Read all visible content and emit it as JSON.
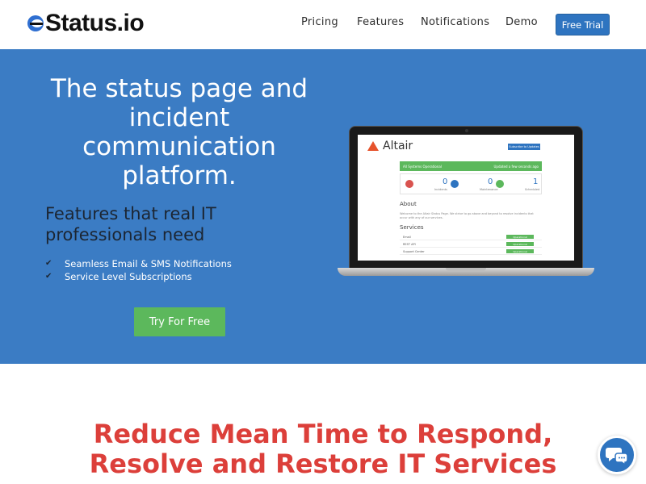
{
  "header": {
    "logo_text": "Status.io",
    "nav": [
      "Pricing",
      "Features",
      "Notifications",
      "Demo"
    ],
    "trial_button": "Free Trial"
  },
  "hero": {
    "title": "The status page and incident communication platform.",
    "subtitle": "Features that real IT professionals need",
    "features": [
      "Seamless Email & SMS Notifications",
      "Service Level Subscriptions"
    ],
    "cta": "Try For Free"
  },
  "preview": {
    "logo": "Altair",
    "subscribe": "Subscribe to Updates",
    "banner": "All Systems Operational",
    "banner_time": "Updated a few seconds ago",
    "stats": [
      {
        "value": "0",
        "label": "Incidents",
        "color": "#d9534f"
      },
      {
        "value": "0",
        "label": "Maintenance",
        "color": "#2e74c0"
      },
      {
        "value": "1",
        "label": "Scheduled",
        "color": "#5cb85c"
      }
    ],
    "about_title": "About",
    "about_text": "Welcome to the Altair Status Page. We strive to go above and beyond to resolve incidents that occur with any of our services.",
    "services_title": "Services",
    "services": [
      "Email",
      "REST API",
      "Support Center"
    ],
    "status": "Operational"
  },
  "section2": {
    "title": "Reduce Mean Time to Respond, Resolve and Restore IT Services"
  },
  "colors": {
    "hero_bg": "#3b7cc4",
    "accent": "#2e74c0",
    "green": "#5cb85c",
    "headline_red": "#dc3f3a"
  }
}
